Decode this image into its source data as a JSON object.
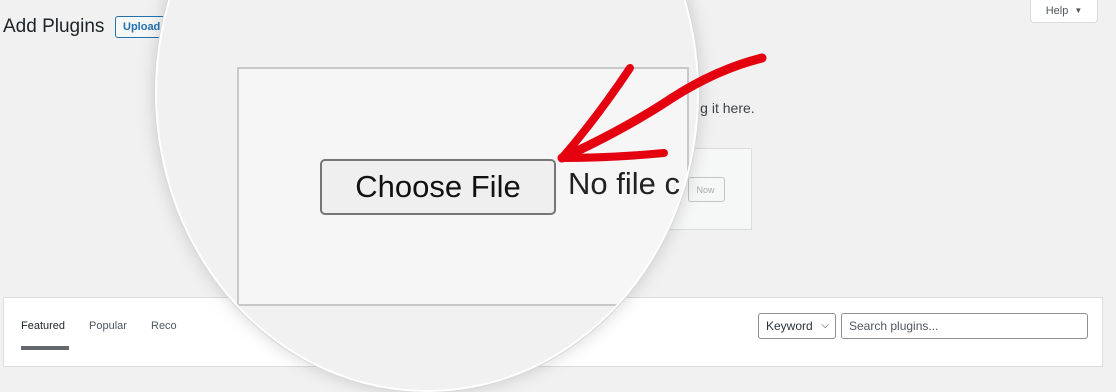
{
  "page": {
    "title": "Add Plugins",
    "upload_button": "Upload Plugin",
    "help": {
      "label": "Help",
      "caret": "▼"
    }
  },
  "upload": {
    "message_visible": "e it by uploading it here.",
    "install_button_visible": "Now"
  },
  "magnifier": {
    "choose_file_label": "Choose File",
    "no_file_text": "No file c"
  },
  "tabs": [
    {
      "label": "Featured",
      "current": true
    },
    {
      "label": "Popular",
      "current": false
    },
    {
      "label": "Reco",
      "current": false
    }
  ],
  "search": {
    "type_selected": "Keyword",
    "chevron": "⌵",
    "placeholder": "Search plugins..."
  },
  "annotation": {
    "arrow_color": "#e4000f"
  }
}
